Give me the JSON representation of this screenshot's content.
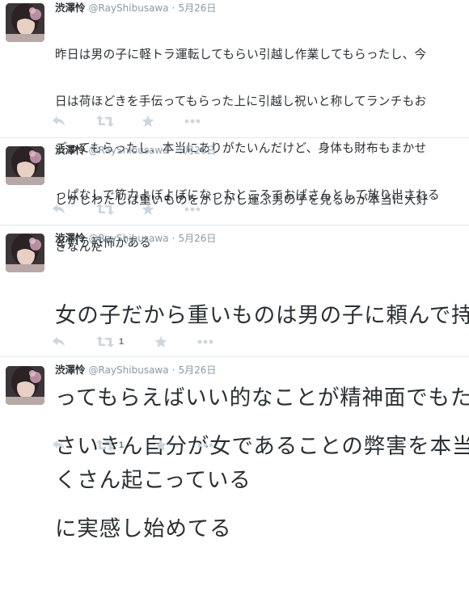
{
  "colors": {
    "text": "#292f33",
    "muted": "#8899a6",
    "icon": "#ccd6dd",
    "divider": "#e1e8ed"
  },
  "tweets": [
    {
      "name": "渋澤怜",
      "handle": "@RayShibusawa",
      "separator": "·",
      "date": "5月26日",
      "text_lines": [
        "昨日は男の子に軽トラ運転してもらい引越し作業してもらったし、今",
        "日は荷ほどきを手伝ってもらった上に引越し祝いと称してランチもお",
        "ごってもらったし、本当にありがたいんだけど、身体も財布もまかせ",
        "っぱなしで筋力よぼよぼになったところでおばさんとして放り出される",
        "という恐怖がある"
      ],
      "retweet_count": "",
      "icons": [
        "reply-icon",
        "retweet-icon",
        "favorite-icon",
        "more-icon"
      ]
    },
    {
      "name": "渋澤怜",
      "handle": "@RayShibusawa",
      "separator": "·",
      "date": "5月26日",
      "text_lines": [
        "しかしわたしは重いものをがしがし運ぶ男の子を見るのが本当に大好",
        "きなんだ"
      ],
      "retweet_count": "",
      "icons": [
        "reply-icon",
        "retweet-icon",
        "favorite-icon",
        "more-icon"
      ]
    },
    {
      "name": "渋澤怜",
      "handle": "@RayShibusawa",
      "separator": "·",
      "date": "5月26日",
      "text_lines": [
        "女の子だから重いものは男の子に頼んで持",
        "ってもらえばいい的なことが精神面でもた",
        "くさん起こっている"
      ],
      "retweet_count": "1",
      "icons": [
        "reply-icon",
        "retweet-icon",
        "favorite-icon",
        "more-icon"
      ]
    },
    {
      "name": "渋澤怜",
      "handle": "@RayShibusawa",
      "separator": "·",
      "date": "5月26日",
      "text_lines": [
        "さいきん自分が女であることの弊害を本当",
        "に実感し始めてる"
      ],
      "retweet_count": "1",
      "icons": [
        "reply-icon",
        "retweet-icon",
        "favorite-icon",
        "more-icon"
      ]
    }
  ]
}
